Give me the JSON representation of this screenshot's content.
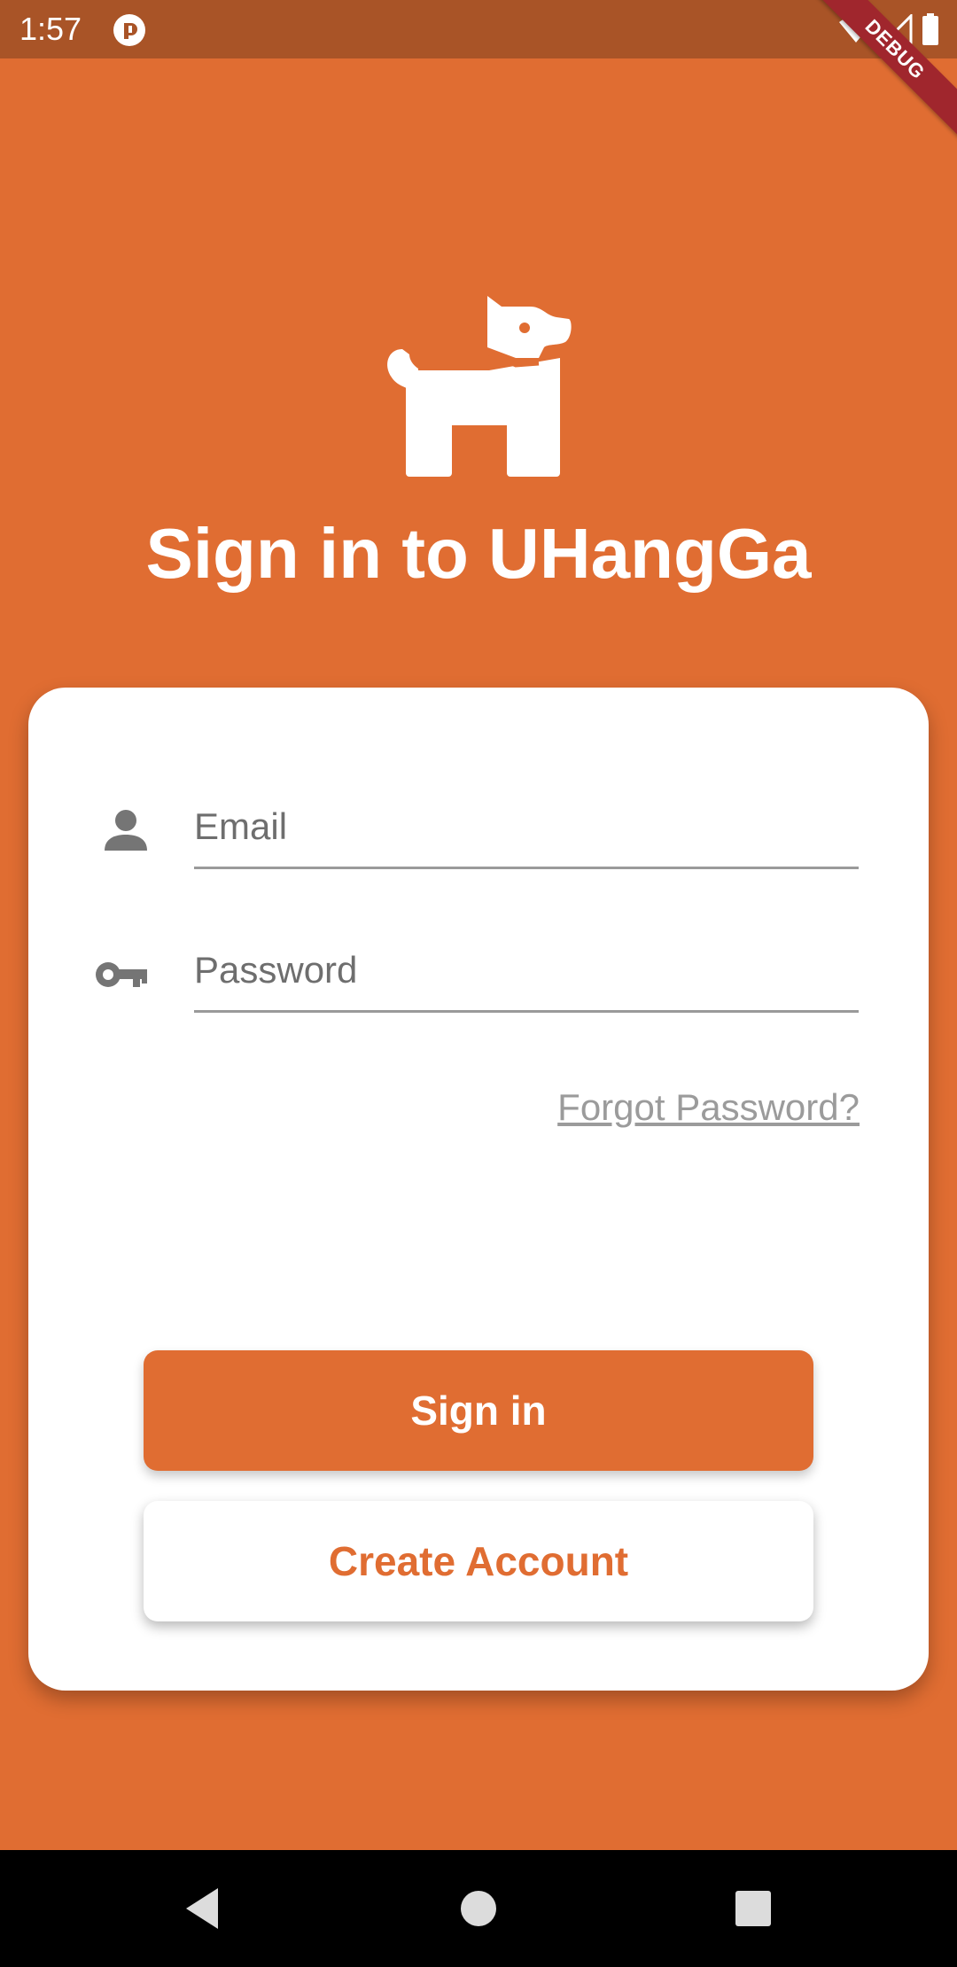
{
  "status_bar": {
    "time": "1:57",
    "debug_label": "DEBUG",
    "icons": [
      "app-notification-icon",
      "wifi-icon",
      "signal-icon",
      "battery-icon"
    ]
  },
  "header": {
    "logo_icon": "dog-icon",
    "title": "Sign in to UHangGa"
  },
  "form": {
    "email": {
      "icon": "person-icon",
      "placeholder": "Email",
      "value": ""
    },
    "password": {
      "icon": "key-icon",
      "placeholder": "Password",
      "value": ""
    },
    "forgot_password": "Forgot Password?",
    "sign_in_label": "Sign in",
    "create_account_label": "Create Account"
  },
  "nav_bar": {
    "buttons": [
      "back-icon",
      "home-icon",
      "recents-icon"
    ]
  },
  "colors": {
    "primary": "#E06D32",
    "status_bar": "#A95427",
    "debug_banner": "#A0262D",
    "card": "#ffffff",
    "icon_gray": "#757575"
  }
}
